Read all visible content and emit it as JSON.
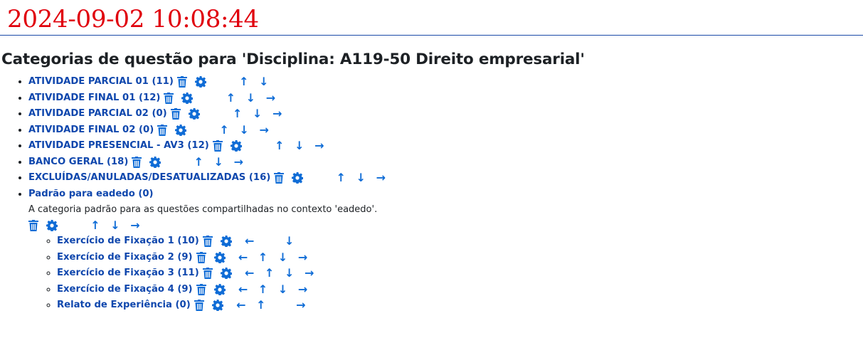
{
  "timestamp": "2024-09-02 10:08:44",
  "heading": "Categorias de questão para 'Disciplina: A119-50 Direito empresarial'",
  "icons": {
    "delete": "trash-icon",
    "edit": "gear-icon",
    "up": "arrow-up-icon",
    "down": "arrow-down-icon",
    "right": "arrow-right-icon",
    "left": "arrow-left-icon"
  },
  "glyphs": {
    "up": "↑",
    "down": "↓",
    "right": "→",
    "left": "←"
  },
  "categories": [
    {
      "label": "ATIVIDADE PARCIAL 01 (11)"
    },
    {
      "label": "ATIVIDADE FINAL 01 (12)"
    },
    {
      "label": "ATIVIDADE PARCIAL 02 (0)"
    },
    {
      "label": "ATIVIDADE FINAL 02 (0)"
    },
    {
      "label": "ATIVIDADE PRESENCIAL - AV3 (12)"
    },
    {
      "label": "BANCO GERAL (18)"
    },
    {
      "label": "EXCLUÍDAS/ANULADAS/DESATUALIZADAS (16)"
    },
    {
      "label": "Padrão para eadedo (0)",
      "description": "A categoria padrão para as questões compartilhadas no contexto 'eadedo'.",
      "subcategories": [
        {
          "label": "Exercício de Fixação 1 (10)"
        },
        {
          "label": "Exercício de Fixação 2 (9)"
        },
        {
          "label": "Exercício de Fixação 3 (11)"
        },
        {
          "label": "Exercício de Fixação 4 (9)"
        },
        {
          "label": "Relato de Experiência (0)"
        }
      ]
    }
  ]
}
